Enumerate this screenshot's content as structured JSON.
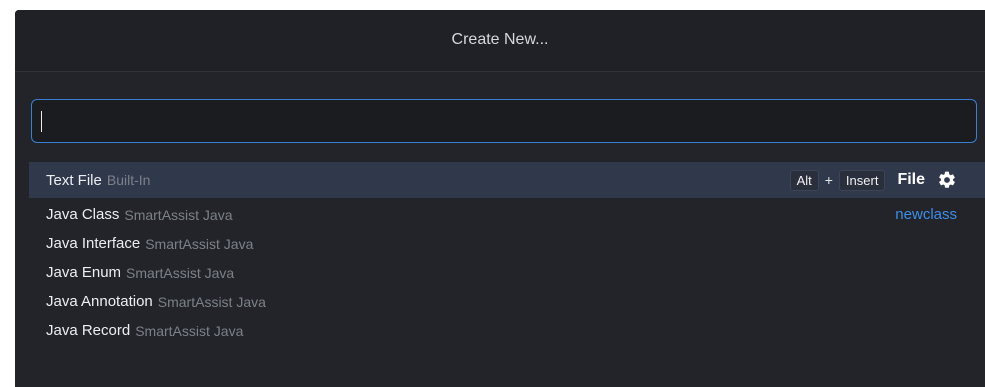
{
  "dialog": {
    "title": "Create New..."
  },
  "search": {
    "value": "",
    "placeholder": ""
  },
  "items": [
    {
      "name": "Text File",
      "source": "Built-In",
      "shortcut_mod": "Alt",
      "shortcut_plus": "+",
      "shortcut_key": "Insert",
      "action": "File",
      "icon": "gear-icon"
    },
    {
      "name": "Java Class",
      "source": "SmartAssist Java",
      "alias": "newclass"
    },
    {
      "name": "Java Interface",
      "source": "SmartAssist Java"
    },
    {
      "name": "Java Enum",
      "source": "SmartAssist Java"
    },
    {
      "name": "Java Annotation",
      "source": "SmartAssist Java"
    },
    {
      "name": "Java Record",
      "source": "SmartAssist Java"
    }
  ],
  "colors": {
    "accent": "#3a7fd0",
    "selection": "#30384b",
    "alias": "#3c8ee8"
  }
}
